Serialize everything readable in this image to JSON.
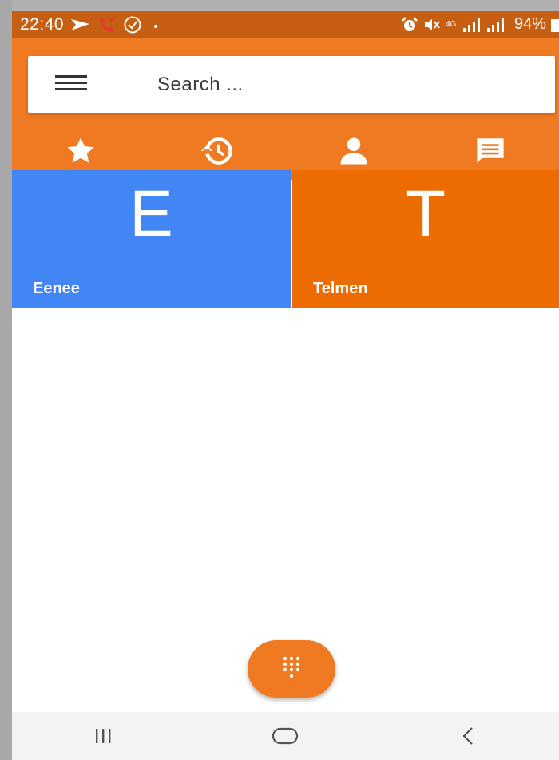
{
  "status_bar": {
    "time": "22:40",
    "network": "4G",
    "battery": "94%",
    "left_icons": [
      "navigation-icon",
      "missed-call-icon",
      "check-circle-icon"
    ],
    "right_icons": [
      "alarm-icon",
      "mute-icon",
      "signal-icon",
      "battery-icon"
    ]
  },
  "search": {
    "placeholder": "Search ...",
    "value": ""
  },
  "tabs": [
    {
      "icon": "star-icon",
      "active": true
    },
    {
      "icon": "history-icon",
      "active": false
    },
    {
      "icon": "person-icon",
      "active": false
    },
    {
      "icon": "message-icon",
      "active": false
    }
  ],
  "favorites": [
    {
      "initial": "E",
      "name": "Eenee",
      "color": "#4285f4"
    },
    {
      "initial": "T",
      "name": "Telmen",
      "color": "#ed6c02"
    }
  ],
  "fab": {
    "icon": "dialpad-icon"
  },
  "nav_bar": [
    {
      "icon": "recent-apps-icon"
    },
    {
      "icon": "home-icon"
    },
    {
      "icon": "back-icon"
    }
  ],
  "colors": {
    "primary": "#f07a21",
    "status_bar": "#c75f12",
    "tile_blue": "#4285f4",
    "tile_orange": "#ed6c02"
  }
}
